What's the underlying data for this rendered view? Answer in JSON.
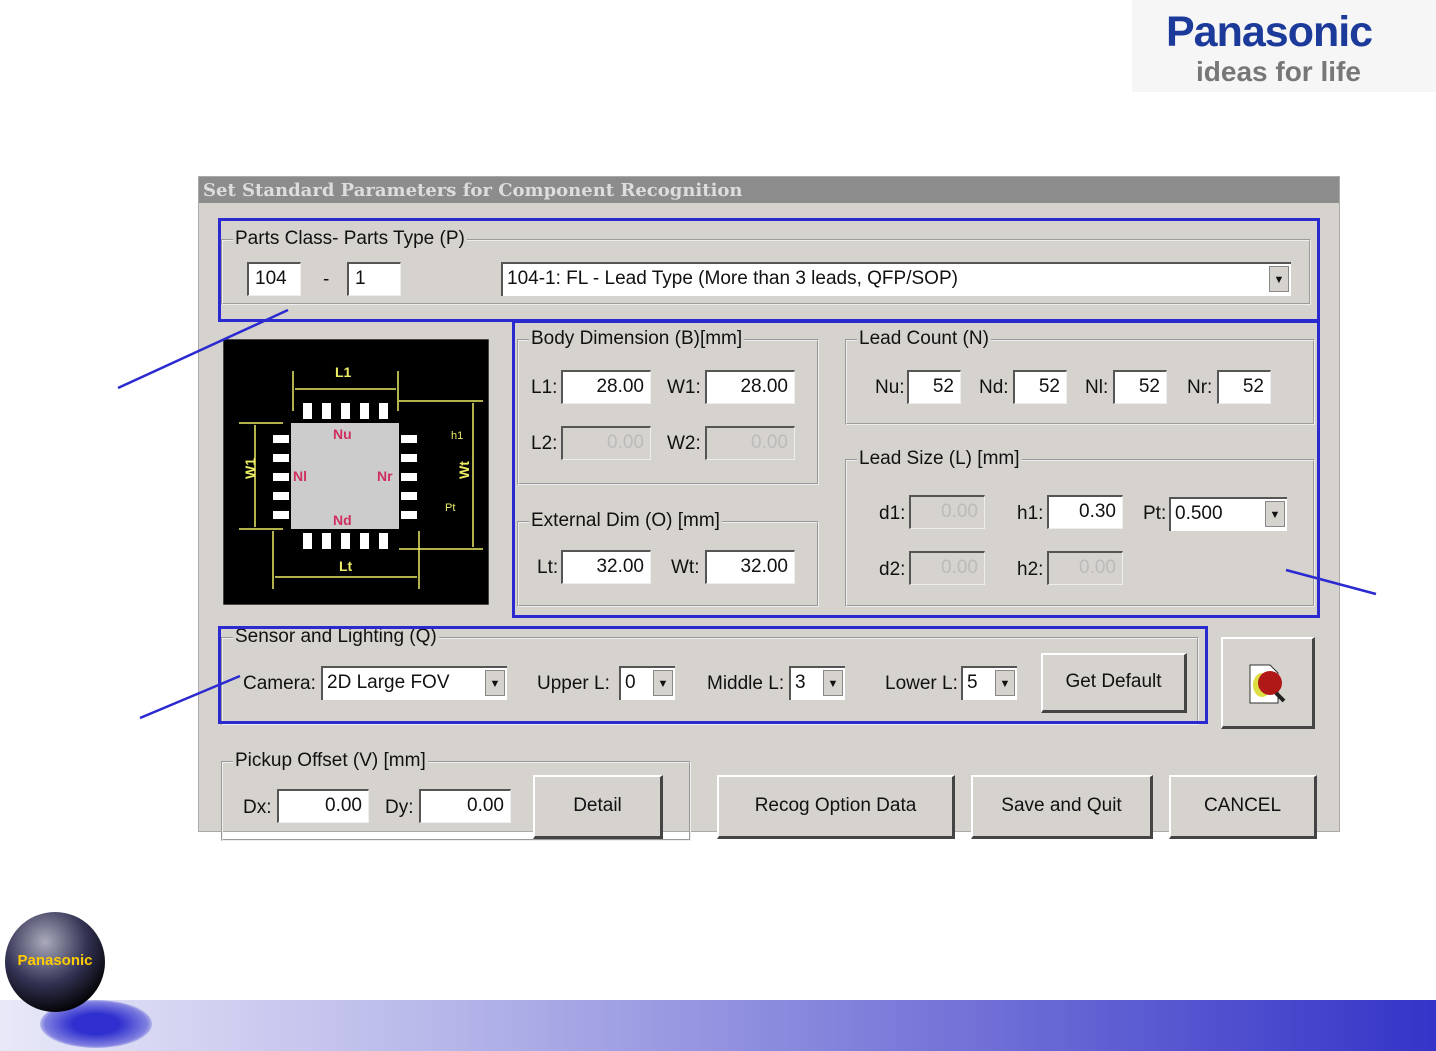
{
  "logo": {
    "brand": "Panasonic",
    "tagline": "ideas for life"
  },
  "dialog": {
    "title": "Set Standard Parameters for Component Recognition",
    "parts": {
      "label": "Parts Class- Parts Type (P)",
      "class": "104",
      "separator": "-",
      "type": "1",
      "description": "104-1: FL - Lead Type (More than 3 leads, QFP/SOP)"
    },
    "diagram": {
      "labels": [
        "L1",
        "W1",
        "Wt",
        "Lt",
        "Nu",
        "Nd",
        "Nl",
        "Nr",
        "h1",
        "Pt"
      ]
    },
    "body_dim": {
      "label": "Body Dimension (B)[mm]",
      "L1_label": "L1:",
      "L1": "28.00",
      "W1_label": "W1:",
      "W1": "28.00",
      "L2_label": "L2:",
      "L2": "0.00",
      "W2_label": "W2:",
      "W2": "0.00"
    },
    "external_dim": {
      "label": "External Dim (O) [mm]",
      "Lt_label": "Lt:",
      "Lt": "32.00",
      "Wt_label": "Wt:",
      "Wt": "32.00"
    },
    "lead_count": {
      "label": "Lead Count (N)",
      "Nu_label": "Nu:",
      "Nu": "52",
      "Nd_label": "Nd:",
      "Nd": "52",
      "Nl_label": "Nl:",
      "Nl": "52",
      "Nr_label": "Nr:",
      "Nr": "52"
    },
    "lead_size": {
      "label": "Lead Size (L) [mm]",
      "d1_label": "d1:",
      "d1": "0.00",
      "h1_label": "h1:",
      "h1": "0.30",
      "Pt_label": "Pt:",
      "Pt": "0.500",
      "d2_label": "d2:",
      "d2": "0.00",
      "h2_label": "h2:",
      "h2": "0.00"
    },
    "sensor": {
      "label": "Sensor and Lighting (Q)",
      "camera_label": "Camera:",
      "camera": "2D Large FOV",
      "upper_label": "Upper L:",
      "upper": "0",
      "middle_label": "Middle L:",
      "middle": "3",
      "lower_label": "Lower L:",
      "lower": "5",
      "get_default": "Get Default"
    },
    "pickup": {
      "label": "Pickup Offset (V) [mm]",
      "dx_label": "Dx:",
      "dx": "0.00",
      "dy_label": "Dy:",
      "dy": "0.00",
      "detail": "Detail"
    },
    "buttons": {
      "recog": "Recog Option Data",
      "save": "Save and Quit",
      "cancel": "CANCEL"
    }
  },
  "footer": {
    "orb_text": "Panasonic"
  },
  "colors": {
    "annotation": "#2a2ad0",
    "title_bar": "#8c8c8c",
    "dialog_bg": "#d6d3ce"
  }
}
